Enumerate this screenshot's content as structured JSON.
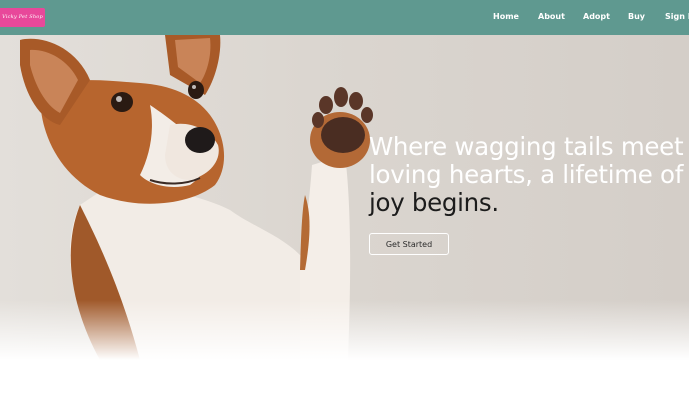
{
  "brand": {
    "logo_text": "Vicky Pet Shop"
  },
  "nav": {
    "items": [
      {
        "label": "Home"
      },
      {
        "label": "About"
      },
      {
        "label": "Adopt"
      },
      {
        "label": "Buy"
      },
      {
        "label": "Sign In"
      }
    ]
  },
  "hero": {
    "headline_light": "Where wagging tails meet loving hearts, a lifetime of",
    "headline_dark": "joy begins.",
    "cta_label": "Get Started"
  },
  "colors": {
    "navbar": "#5f9990",
    "logo_bg": "#e8489a",
    "hero_bg": "#dcd7d1"
  }
}
